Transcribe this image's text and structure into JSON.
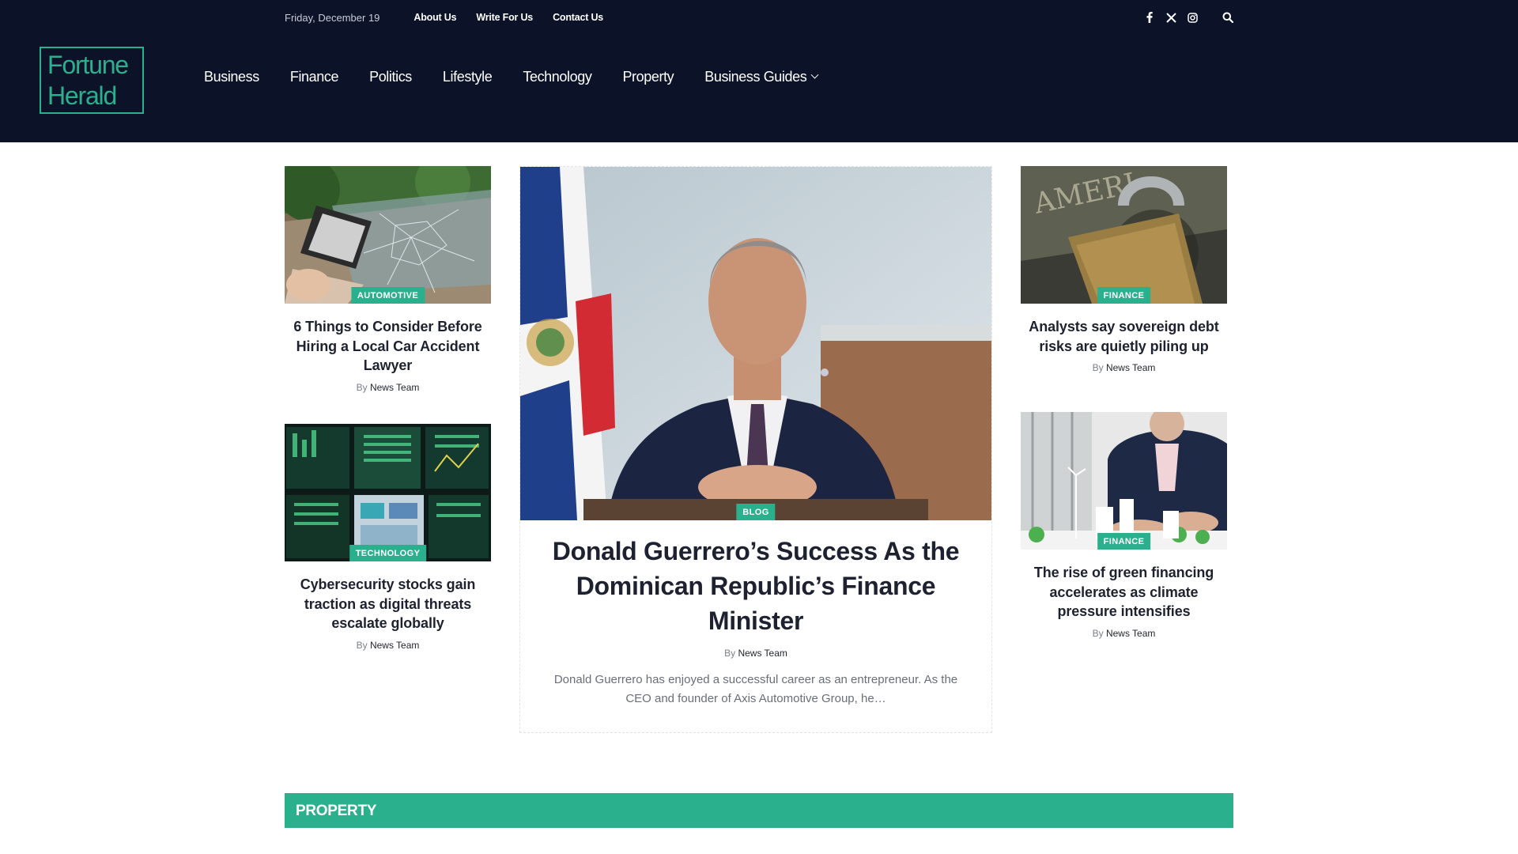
{
  "header": {
    "date": "Friday, December 19",
    "top_links": [
      "About Us",
      "Write For Us",
      "Contact Us"
    ],
    "social_icons": [
      "facebook-icon",
      "x-icon",
      "instagram-icon"
    ],
    "logo_line1": "Fortune",
    "logo_line2": "Herald",
    "nav": [
      "Business",
      "Finance",
      "Politics",
      "Lifestyle",
      "Technology",
      "Property",
      "Business Guides"
    ]
  },
  "colors": {
    "accent": "#2bb08d",
    "header_bg": "#0c1228"
  },
  "articles": {
    "left_top": {
      "category": "AUTOMOTIVE",
      "title": "6 Things to Consider Before Hiring a Local Car Accident Lawyer",
      "by": "By",
      "author": "News Team"
    },
    "left_bottom": {
      "category": "TECHNOLOGY",
      "title": "Cybersecurity stocks gain traction as digital threats escalate globally",
      "by": "By",
      "author": "News Team"
    },
    "feature": {
      "category": "BLOG",
      "title": "Donald Guerrero’s Success As the Dominican Republic’s Finance Minister",
      "by": "By",
      "author": "News Team",
      "excerpt": "Donald Guerrero has enjoyed a successful career as an entrepreneur. As the CEO and founder of Axis Automotive Group, he…"
    },
    "right_top": {
      "category": "FINANCE",
      "title": "Analysts say sovereign debt risks are quietly piling up",
      "by": "By",
      "author": "News Team"
    },
    "right_bottom": {
      "category": "FINANCE",
      "title": "The rise of green financing accelerates as climate pressure intensifies",
      "by": "By",
      "author": "News Team"
    }
  },
  "section": {
    "title": "PROPERTY"
  }
}
